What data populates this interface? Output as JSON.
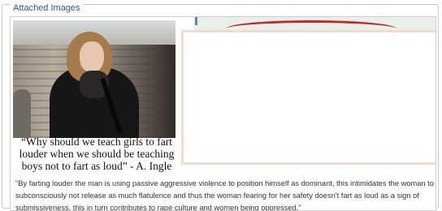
{
  "section": {
    "legend": "Attached Images"
  },
  "image": {
    "caption": "“Why should we teach girls to fart louder when we should be teaching boys not to fart as loud” - A. Ingle",
    "quote": "\"By farting louder the man is using passive aggressive violence to position himself as dominant, this intimidates the woman to subconsciously not release as much flatulence and thus the woman fearing for her safety doesn't fart as loud as a sign of submissiveness, this in turn contributes to rape culture and women being oppressed.\""
  },
  "colors": {
    "legend_text": "#2a5699",
    "border": "#c3cad6",
    "panel_border": "#f4d9cd",
    "red_mark": "#c8242c"
  }
}
